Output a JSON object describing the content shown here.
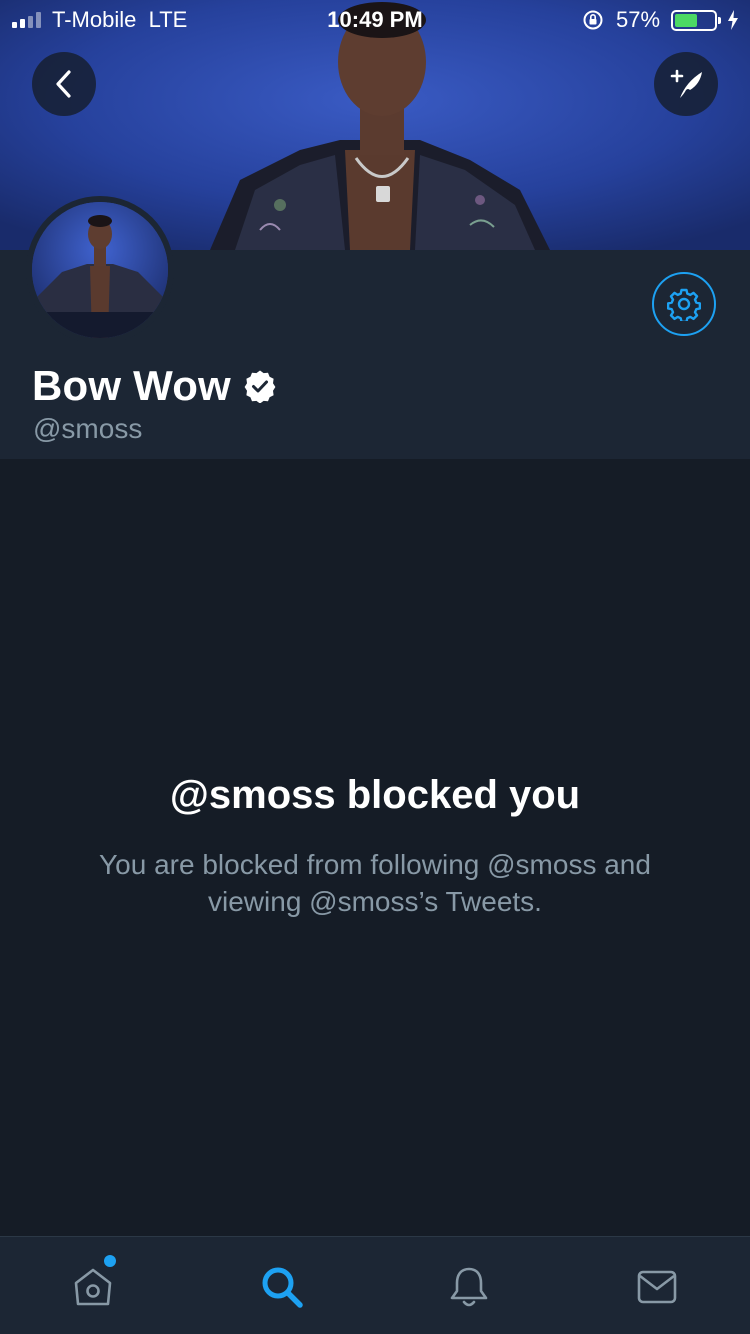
{
  "status_bar": {
    "carrier": "T-Mobile",
    "network": "LTE",
    "time": "10:49 PM",
    "battery_percent": "57%",
    "battery_level": 0.57,
    "signal_bars": 2
  },
  "profile": {
    "display_name": "Bow Wow",
    "handle": "@smoss",
    "verified": true
  },
  "blocked": {
    "title": "@smoss blocked you",
    "description": "You are blocked from following @smoss and viewing @smoss’s Tweets."
  },
  "tabs": [
    {
      "name": "home",
      "icon": "home-icon",
      "active": false,
      "has_notification_dot": true
    },
    {
      "name": "search",
      "icon": "search-icon",
      "active": true
    },
    {
      "name": "notifications",
      "icon": "bell-icon",
      "active": false
    },
    {
      "name": "messages",
      "icon": "envelope-icon",
      "active": false
    }
  ],
  "colors": {
    "accent": "#1da1f2",
    "background": "#151c26",
    "panel": "#1c2634",
    "secondary_text": "#8899a6",
    "battery_fill": "#4cd964"
  }
}
